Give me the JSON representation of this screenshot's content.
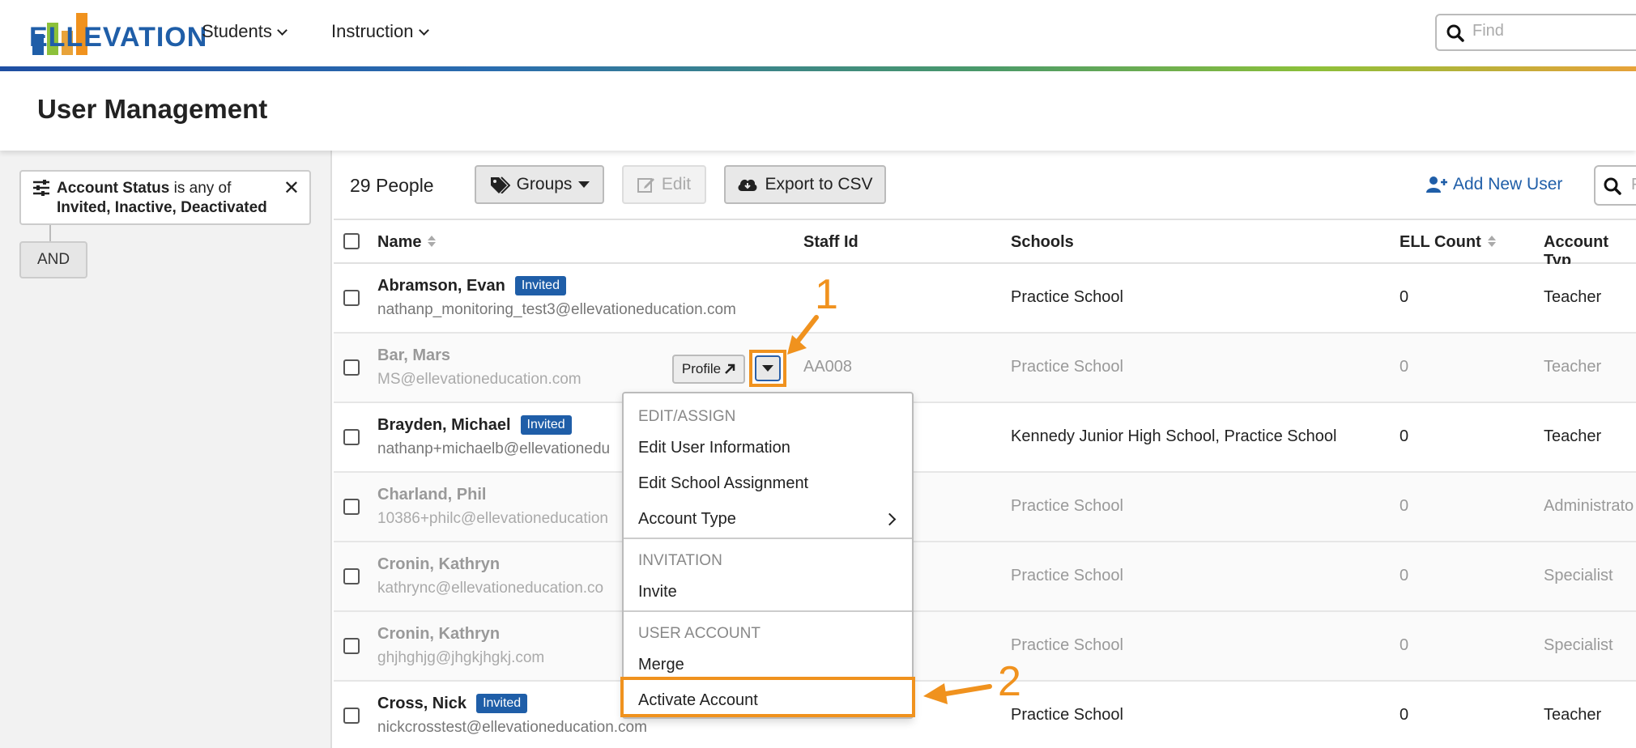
{
  "nav": {
    "logo_text": "ELLEVATION",
    "items": [
      {
        "label": "Students"
      },
      {
        "label": "Instruction"
      }
    ],
    "find_placeholder": "Find"
  },
  "page": {
    "title": "User Management"
  },
  "filter": {
    "field": "Account Status",
    "operator": "is any of",
    "values": "Invited, Inactive, Deactivated",
    "and_label": "AND"
  },
  "toolbar": {
    "count": "29 People",
    "groups_label": "Groups",
    "edit_label": "Edit",
    "export_label": "Export to CSV",
    "add_user_label": "Add New User",
    "search_placeholder": "F"
  },
  "table": {
    "headers": {
      "name": "Name",
      "staff_id": "Staff Id",
      "schools": "Schools",
      "ell_count": "ELL Count",
      "account_type": "Account Typ"
    },
    "rows": [
      {
        "name": "Abramson, Evan",
        "badge": "Invited",
        "email": "nathanp_monitoring_test3@ellevationeducation.com",
        "staff_id": "",
        "schools": "Practice School",
        "ell_count": "0",
        "account_type": "Teacher"
      },
      {
        "name": "Bar, Mars",
        "badge": "",
        "email": "MS@ellevationeducation.com",
        "staff_id": "AA008",
        "schools": "Practice School",
        "ell_count": "0",
        "account_type": "Teacher"
      },
      {
        "name": "Brayden, Michael",
        "badge": "Invited",
        "email": "nathanp+michaelb@ellevationedu",
        "staff_id": "",
        "schools": "Kennedy Junior High School, Practice School",
        "ell_count": "0",
        "account_type": "Teacher"
      },
      {
        "name": "Charland, Phil",
        "badge": "",
        "email": "10386+philc@ellevationeducation",
        "staff_id": "",
        "schools": "Practice School",
        "ell_count": "0",
        "account_type": "Administrato"
      },
      {
        "name": "Cronin, Kathryn",
        "badge": "",
        "email": "kathrync@ellevationeducation.co",
        "staff_id": "",
        "schools": "Practice School",
        "ell_count": "0",
        "account_type": "Specialist"
      },
      {
        "name": "Cronin, Kathryn",
        "badge": "",
        "email": "ghjhghjg@jhgkjhgkj.com",
        "staff_id": "",
        "schools": "Practice School",
        "ell_count": "0",
        "account_type": "Specialist"
      },
      {
        "name": "Cross, Nick",
        "badge": "Invited",
        "email": "nickcrosstest@ellevationeducation.com",
        "staff_id": "",
        "schools": "Practice School",
        "ell_count": "0",
        "account_type": "Teacher"
      }
    ],
    "profile_label": "Profile"
  },
  "menu": {
    "section_edit": "EDIT/ASSIGN",
    "edit_user_info": "Edit User Information",
    "edit_school_assignment": "Edit School Assignment",
    "account_type": "Account Type",
    "section_invitation": "INVITATION",
    "invite": "Invite",
    "section_user_account": "USER ACCOUNT",
    "merge": "Merge",
    "activate_account": "Activate Account"
  },
  "annotations": {
    "step1": "1",
    "step2": "2",
    "color": "#f0921e"
  },
  "colors": {
    "brand_blue": "#1f5ea8",
    "highlight_orange": "#f0921e"
  }
}
